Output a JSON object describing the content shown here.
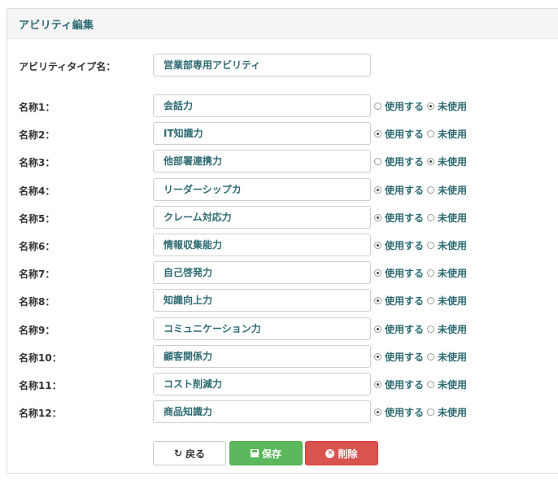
{
  "panel": {
    "title": "アビリティ編集"
  },
  "type_name": {
    "label": "アビリティタイプ名：",
    "value": "営業部専用アビリティ"
  },
  "use_label": "使用する",
  "unused_label": "未使用",
  "rows": [
    {
      "label": "名称1：",
      "value": "会話力",
      "used": false
    },
    {
      "label": "名称2：",
      "value": "IT知識力",
      "used": true
    },
    {
      "label": "名称3：",
      "value": "他部署連携力",
      "used": false
    },
    {
      "label": "名称4：",
      "value": "リーダーシップカ",
      "used": true
    },
    {
      "label": "名称5：",
      "value": "クレーム対応力",
      "used": true
    },
    {
      "label": "名称6：",
      "value": "情報収集能力",
      "used": true
    },
    {
      "label": "名称7：",
      "value": "自己啓発力",
      "used": true
    },
    {
      "label": "名称8：",
      "value": "知識向上力",
      "used": true
    },
    {
      "label": "名称9：",
      "value": "コミュニケーション力",
      "used": true
    },
    {
      "label": "名称10：",
      "value": "顧客関係力",
      "used": true
    },
    {
      "label": "名称11：",
      "value": "コスト削減力",
      "used": true
    },
    {
      "label": "名称12：",
      "value": "商品知識力",
      "used": true
    }
  ],
  "buttons": {
    "back": "戻る",
    "save": "保存",
    "delete": "削除"
  },
  "icons": {
    "back": "refresh-icon",
    "save": "save-icon",
    "delete": "delete-icon"
  },
  "colors": {
    "accent": "#2e6b73",
    "save": "#5cb85c",
    "delete": "#d9534f"
  }
}
